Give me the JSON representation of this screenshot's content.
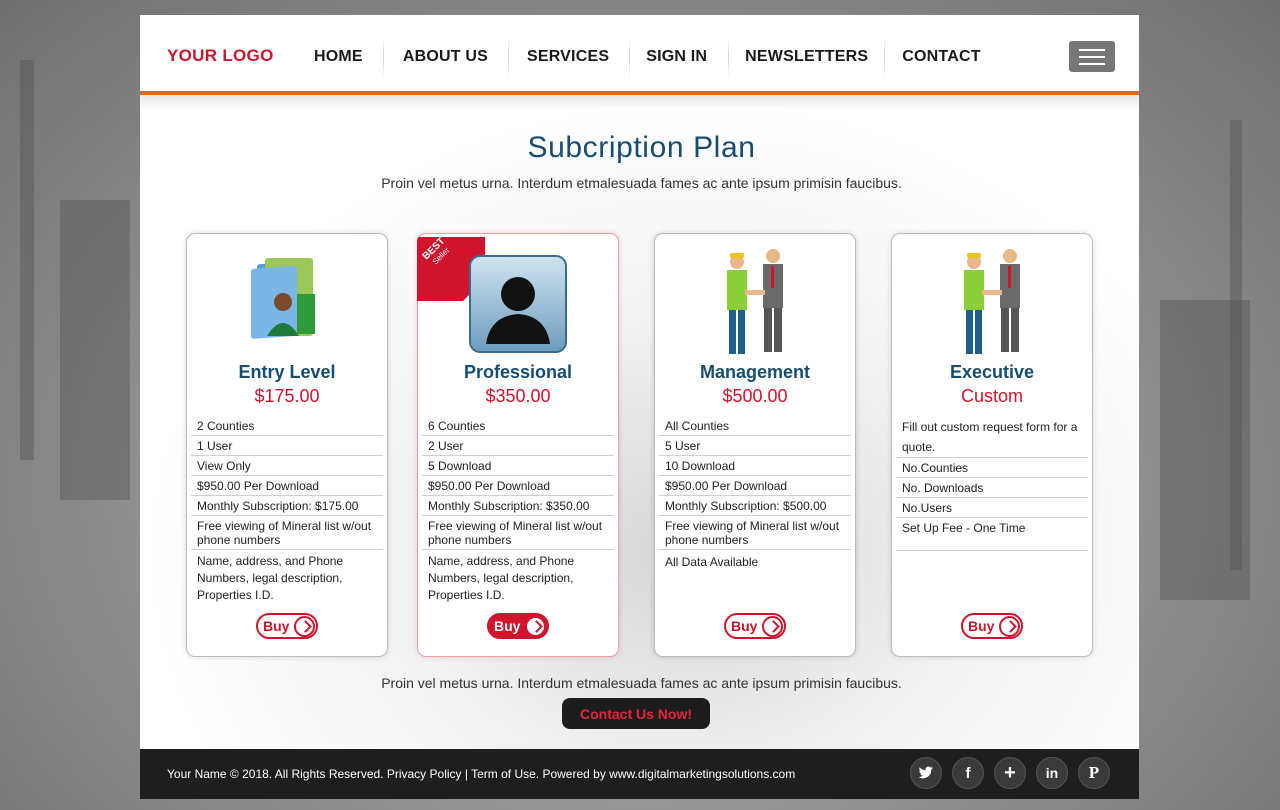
{
  "header": {
    "logo": "YOUR LOGO",
    "nav": [
      "HOME",
      "ABOUT US",
      "SERVICES",
      "SIGN IN",
      "NEWSLETTERS",
      "CONTACT"
    ]
  },
  "main": {
    "title": "Subcription Plan",
    "subtitle": "Proin vel metus urna. Interdum etmalesuada fames ac ante ipsum primisin faucibus.",
    "plans": [
      {
        "name": "Entry Level",
        "price": "$175.00",
        "features": [
          "2 Counties",
          "1 User",
          "View Only",
          "$950.00 Per Download",
          "Monthly Subscription: $175.00",
          "Free viewing of Mineral list w/out phone numbers",
          "Name, address, and Phone Numbers, legal description, Properties I.D."
        ],
        "buy": "Buy"
      },
      {
        "name": "Professional",
        "price": "$350.00",
        "ribbon": "BEST",
        "ribbon_sub": "Seller",
        "features": [
          "6 Counties",
          "2 User",
          "5 Download",
          "$950.00 Per Download",
          "Monthly Subscription: $350.00",
          "Free viewing of Mineral list w/out phone numbers",
          "Name, address, and Phone Numbers, legal description, Properties I.D."
        ],
        "buy": "Buy"
      },
      {
        "name": "Management",
        "price": "$500.00",
        "features": [
          "All Counties",
          "5 User",
          "10 Download",
          "$950.00 Per Download",
          "Monthly Subscription: $500.00",
          "Free viewing of Mineral list w/out phone numbers",
          "All Data Available"
        ],
        "buy": "Buy"
      },
      {
        "name": "Executive",
        "price": "Custom",
        "features": [
          "Fill out custom request form for a quote.",
          "No.Counties",
          "No. Downloads",
          "No.Users",
          "Set Up Fee - One Time"
        ],
        "buy": "Buy"
      }
    ],
    "bottom_text": "Proin vel metus urna. Interdum etmalesuada fames ac ante ipsum primisin faucibus.",
    "contact_button": "Contact Us Now!"
  },
  "footer": {
    "copyright": "Your Name © 2018. All Rights Reserved.  Privacy Policy | Term of Use. Powered by www.digitalmarketingsolutions.com",
    "social": [
      "twitter-icon",
      "facebook-icon",
      "plus-icon",
      "linkedin-icon",
      "pinterest-icon"
    ]
  },
  "colors": {
    "brand_red": "#d0142c",
    "title_blue": "#174c73",
    "accent_orange": "#d9682a"
  }
}
